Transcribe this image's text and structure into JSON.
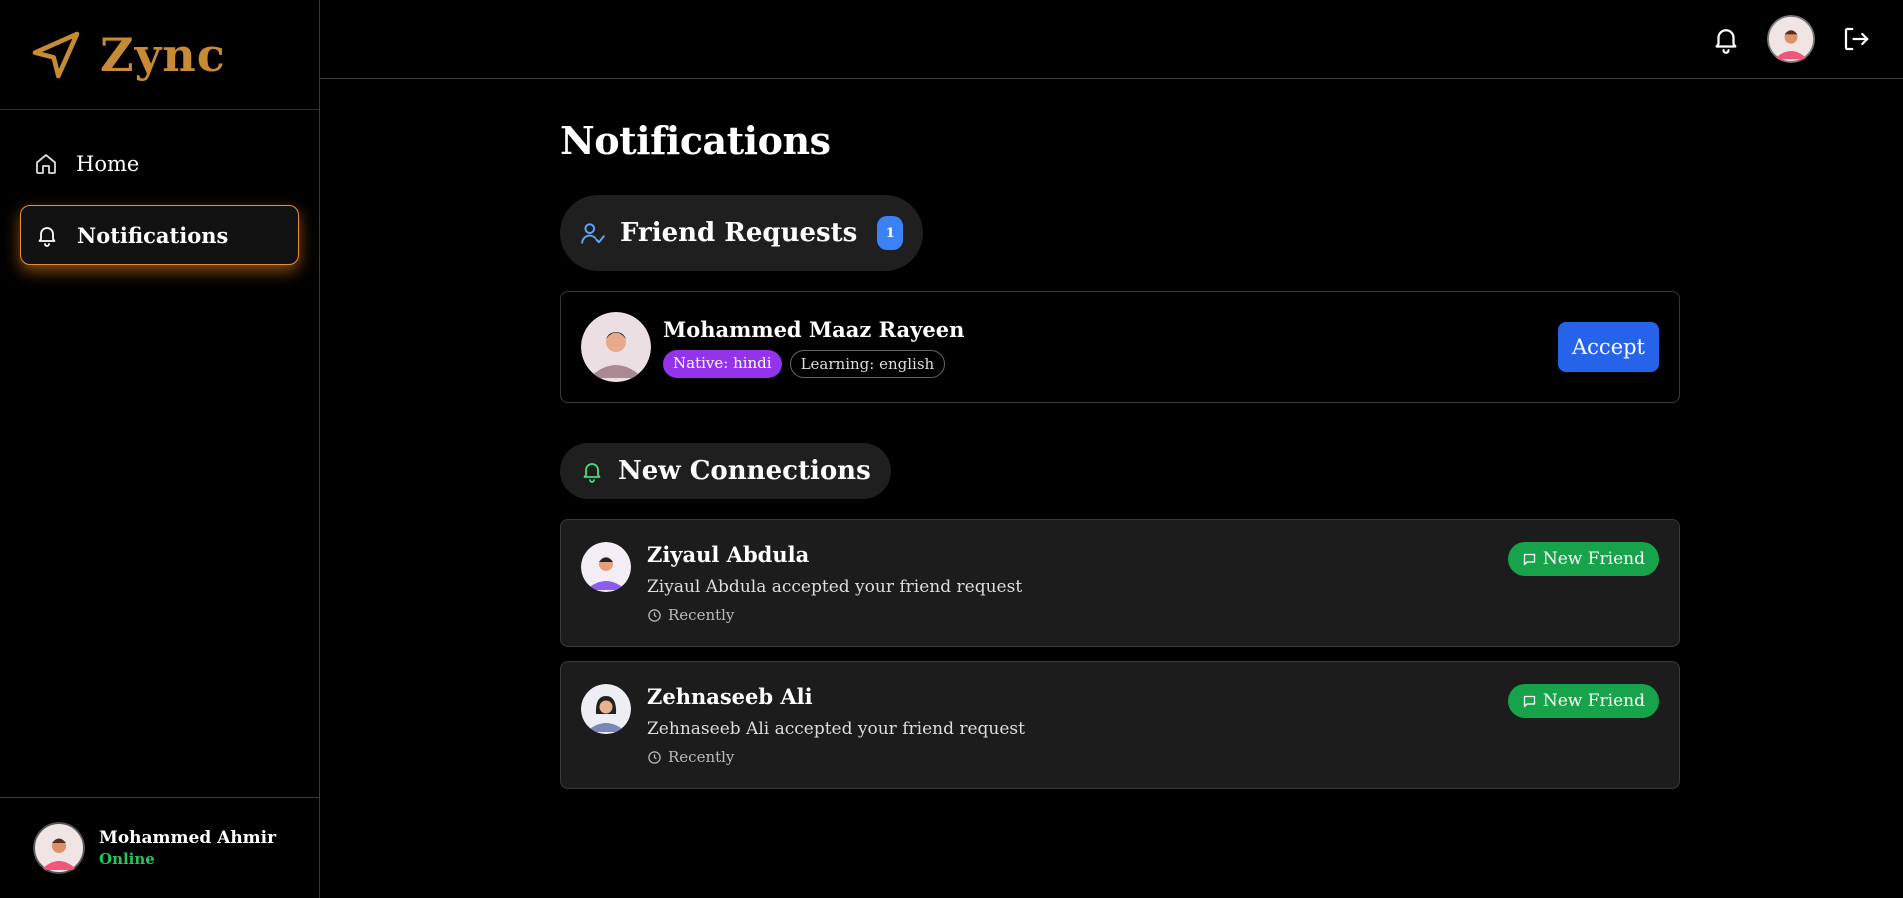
{
  "app": {
    "name": "Zync",
    "accent": "#c88a35"
  },
  "sidebar": {
    "items": [
      {
        "label": "Home",
        "icon": "home-icon"
      },
      {
        "label": "Notifications",
        "icon": "bell-icon",
        "active": true
      }
    ],
    "user": {
      "name": "Mohammed Ahmir",
      "status": "Online"
    }
  },
  "topbar": {
    "icons": [
      "bell-icon",
      "avatar",
      "logout-icon"
    ]
  },
  "page": {
    "title": "Notifications"
  },
  "friend_requests": {
    "title": "Friend Requests",
    "count": "1",
    "items": [
      {
        "name": "Mohammed Maaz Rayeen",
        "native": "Native: hindi",
        "learning": "Learning: english",
        "action": "Accept"
      }
    ]
  },
  "new_connections": {
    "title": "New Connections",
    "items": [
      {
        "name": "Ziyaul Abdula",
        "message": "Ziyaul Abdula accepted your friend request",
        "time": "Recently",
        "badge": "New Friend"
      },
      {
        "name": "Zehnaseeb Ali",
        "message": "Zehnaseeb Ali accepted your friend request",
        "time": "Recently",
        "badge": "New Friend"
      }
    ]
  },
  "colors": {
    "active_glow": "#e8902e",
    "accept": "#2563eb",
    "new_friend": "#16a34a",
    "native_tag": "#9333ea",
    "online": "#22c55e",
    "badge": "#3b82f6"
  }
}
